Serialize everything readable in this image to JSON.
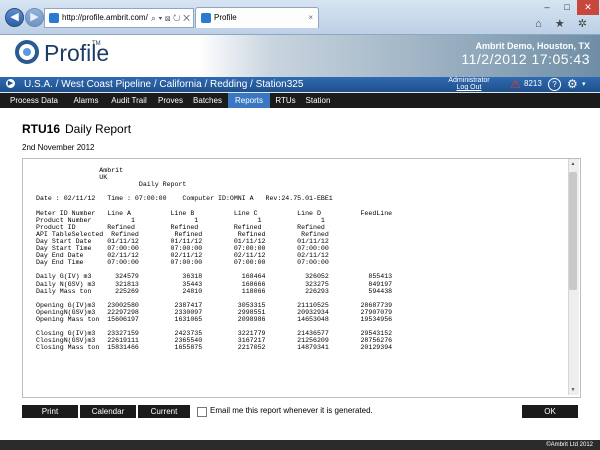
{
  "browser": {
    "url": "http://profile.ambrit.com/",
    "tab_title": "Profile",
    "address_tools": "⌕ ▾ ⊠ ↻ ✕",
    "close_tab": "×"
  },
  "window_controls": {
    "minimize": "–",
    "maximize": "□",
    "close": "✕"
  },
  "browser_icons": "⌂ ★ ✲",
  "header": {
    "logo": "Profile",
    "logo_tm": "TM",
    "org": "Ambrit Demo, Houston, TX",
    "datetime": "11/2/2012  17:05:43"
  },
  "breadcrumb": {
    "text": "U.S.A. / West Coast Pipeline / California / Redding / Station325",
    "user_line1": "Administrator",
    "user_line2": "Log Out",
    "alert_icon": "⚠",
    "alarm_count": "8213",
    "help_label": "?",
    "settings_icon": "⚙",
    "settings_caret": "▾"
  },
  "nav": {
    "items": [
      "Process Data",
      "Alarms",
      "Audit Trail",
      "Proves",
      "Batches",
      "Reports",
      "RTUs",
      "Station"
    ],
    "active_index": 5
  },
  "page": {
    "rtu": "RTU16",
    "title": "Daily Report",
    "date": "2nd November 2012"
  },
  "report_text": "                Ambrit\n                UK\n                          Daily Report\n\nDate : 02/11/12   Time : 07:00:00    Computer ID:OMNI A   Rev:24.75.01-EBE1\n\nMeter ID Number   Line A          Line B          Line C          Line D          FeedLine\nProduct Number          1               1               1               1\nProduct ID        Refined         Refined         Refined         Refined\nAPI TableSelected  Refined         Refined         Refined         Refined\nDay Start Date    01/11/12        01/11/12        01/11/12        01/11/12\nDay Start Time    07:00:00        07:00:00        07:00:00        07:00:00\nDay End Date      02/11/12        02/11/12        02/11/12        02/11/12\nDay End Time      07:00:00        07:00:00        07:00:00        07:00:00\n\nDaily G(IV) m3      324579           36318          168464          326052          855413\nDaily N(GSV) m3     321813           35443          168666          323275          849197\nDaily Mass ton      225269           24810          118066          226293          594438\n\nOpening G(IV)m3   23002580         2387417         3053315        21110525        28687739\nOpeningN(GSV)m3   22297298         2330097         2998551        20932934        27907079\nOpening Mass ton  15606197         1631065         2098986        14653048        19534956\n\nClosing G(IV)m3   23327159         2423735         3221779        21436577        29543152\nClosingN(GSV)m3   22619111         2365540         3167217        21256209        28756276\nClosing Mass ton  15831466         1655875         2217052        14879341        20129394",
  "buttons": {
    "print": "Print",
    "calendar": "Calendar",
    "current": "Current",
    "ok": "OK"
  },
  "email_label": "Email me this report whenever it is generated.",
  "scrollbar": {
    "up": "▲",
    "down": "▼"
  },
  "copyright": "©Ambrit Ltd 2012",
  "colors": {
    "header_blue": "#1f4f8a",
    "nav_active": "#3a77c2",
    "nav_bg": "#1b1b1b",
    "alert_red": "#e63a2e"
  }
}
